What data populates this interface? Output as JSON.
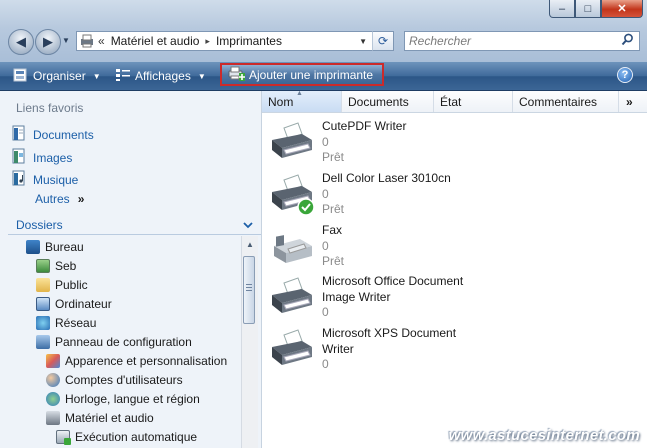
{
  "window": {
    "minimize_label": "–",
    "maximize_label": "□",
    "close_label": "✕"
  },
  "address": {
    "chevrons": "«",
    "crumbs": [
      "Matériel et audio",
      "Imprimantes"
    ],
    "separator": "▸"
  },
  "search": {
    "placeholder": "Rechercher"
  },
  "toolbar": {
    "organize_label": "Organiser",
    "views_label": "Affichages",
    "add_printer_label": "Ajouter une imprimante"
  },
  "favorites": {
    "title": "Liens favoris",
    "items": [
      "Documents",
      "Images",
      "Musique"
    ],
    "more_label": "Autres",
    "more_chevron": "»"
  },
  "folders": {
    "title": "Dossiers",
    "items": [
      {
        "label": "Bureau",
        "icon": "desktop-icon"
      },
      {
        "label": "Seb",
        "icon": "user-folder-icon"
      },
      {
        "label": "Public",
        "icon": "folder-icon"
      },
      {
        "label": "Ordinateur",
        "icon": "computer-icon"
      },
      {
        "label": "Réseau",
        "icon": "network-icon"
      },
      {
        "label": "Panneau de configuration",
        "icon": "control-panel-icon"
      },
      {
        "label": "Apparence et personnalisation",
        "icon": "appearance-icon"
      },
      {
        "label": "Comptes d'utilisateurs",
        "icon": "users-icon"
      },
      {
        "label": "Horloge, langue et région",
        "icon": "clock-globe-icon"
      },
      {
        "label": "Matériel et audio",
        "icon": "hardware-icon"
      },
      {
        "label": "Exécution automatique",
        "icon": "autoplay-icon"
      }
    ]
  },
  "columns": [
    "Nom",
    "Documents",
    "État",
    "Commentaires"
  ],
  "columns_more": "»",
  "printers": [
    {
      "name": "CutePDF Writer",
      "docs": "0",
      "status": "Prêt",
      "icon": "printer-icon"
    },
    {
      "name": "Dell Color Laser 3010cn",
      "docs": "0",
      "status": "Prêt",
      "icon": "default-printer-icon"
    },
    {
      "name": "Fax",
      "docs": "0",
      "status": "Prêt",
      "icon": "fax-icon"
    },
    {
      "name": "Microsoft Office Document\nImage Writer",
      "name_line1": "Microsoft Office Document",
      "name_line2": "Image Writer",
      "docs": "0",
      "icon": "printer-icon"
    },
    {
      "name_line1": "Microsoft XPS Document",
      "name_line2": "Writer",
      "docs": "0",
      "icon": "printer-icon"
    }
  ],
  "watermark": "www.astucesinternet.com",
  "colors": {
    "toolbar_top": "#6e93bb",
    "toolbar_bottom": "#2c5687",
    "link": "#1c5fa8",
    "highlight_border": "#cc2a2a"
  }
}
